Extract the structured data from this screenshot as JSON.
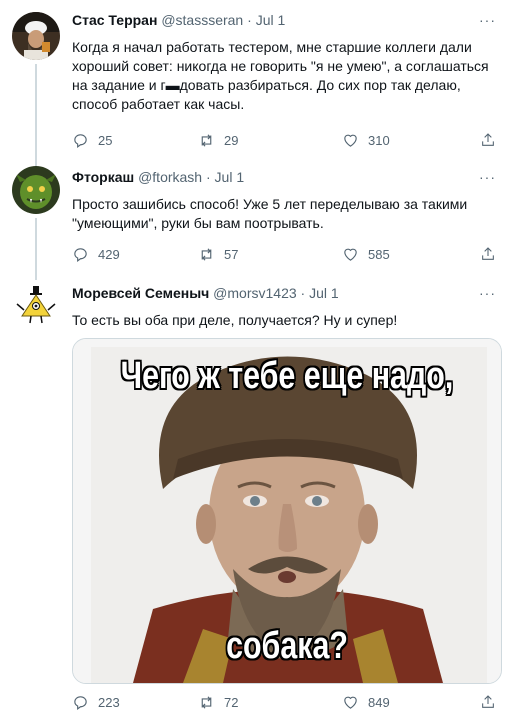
{
  "tweets": [
    {
      "name": "Стас Терран",
      "handle": "@stassseran",
      "date": "Jul 1",
      "text": "Когда я начал работать тестером, мне старшие коллеги дали хороший совет: никогда не говорить \"я не умею\", а соглашаться на задание и г▬довать разбираться. До сих пор так делаю, способ работает как часы.",
      "replies": "25",
      "retweets": "29",
      "likes": "310"
    },
    {
      "name": "Фторкаш",
      "handle": "@ftorkash",
      "date": "Jul 1",
      "text": "Просто зашибись способ! Уже 5 лет переделываю за такими \"умеющими\", руки бы вам поотрывать.",
      "replies": "429",
      "retweets": "57",
      "likes": "585"
    },
    {
      "name": "Моревсей Семеныч",
      "handle": "@morsv1423",
      "date": "Jul 1",
      "text": "То есть вы оба при деле, получается? Ну и супер!",
      "replies": "223",
      "retweets": "72",
      "likes": "849"
    }
  ],
  "meme": {
    "top_caption": "Чего ж тебе еще надо,",
    "bottom_caption": "собака?"
  },
  "ui": {
    "separator": "·",
    "more": "···"
  },
  "colors": {
    "text": "#0f1419",
    "secondary": "#536471",
    "thread_line": "#cfd9de"
  }
}
